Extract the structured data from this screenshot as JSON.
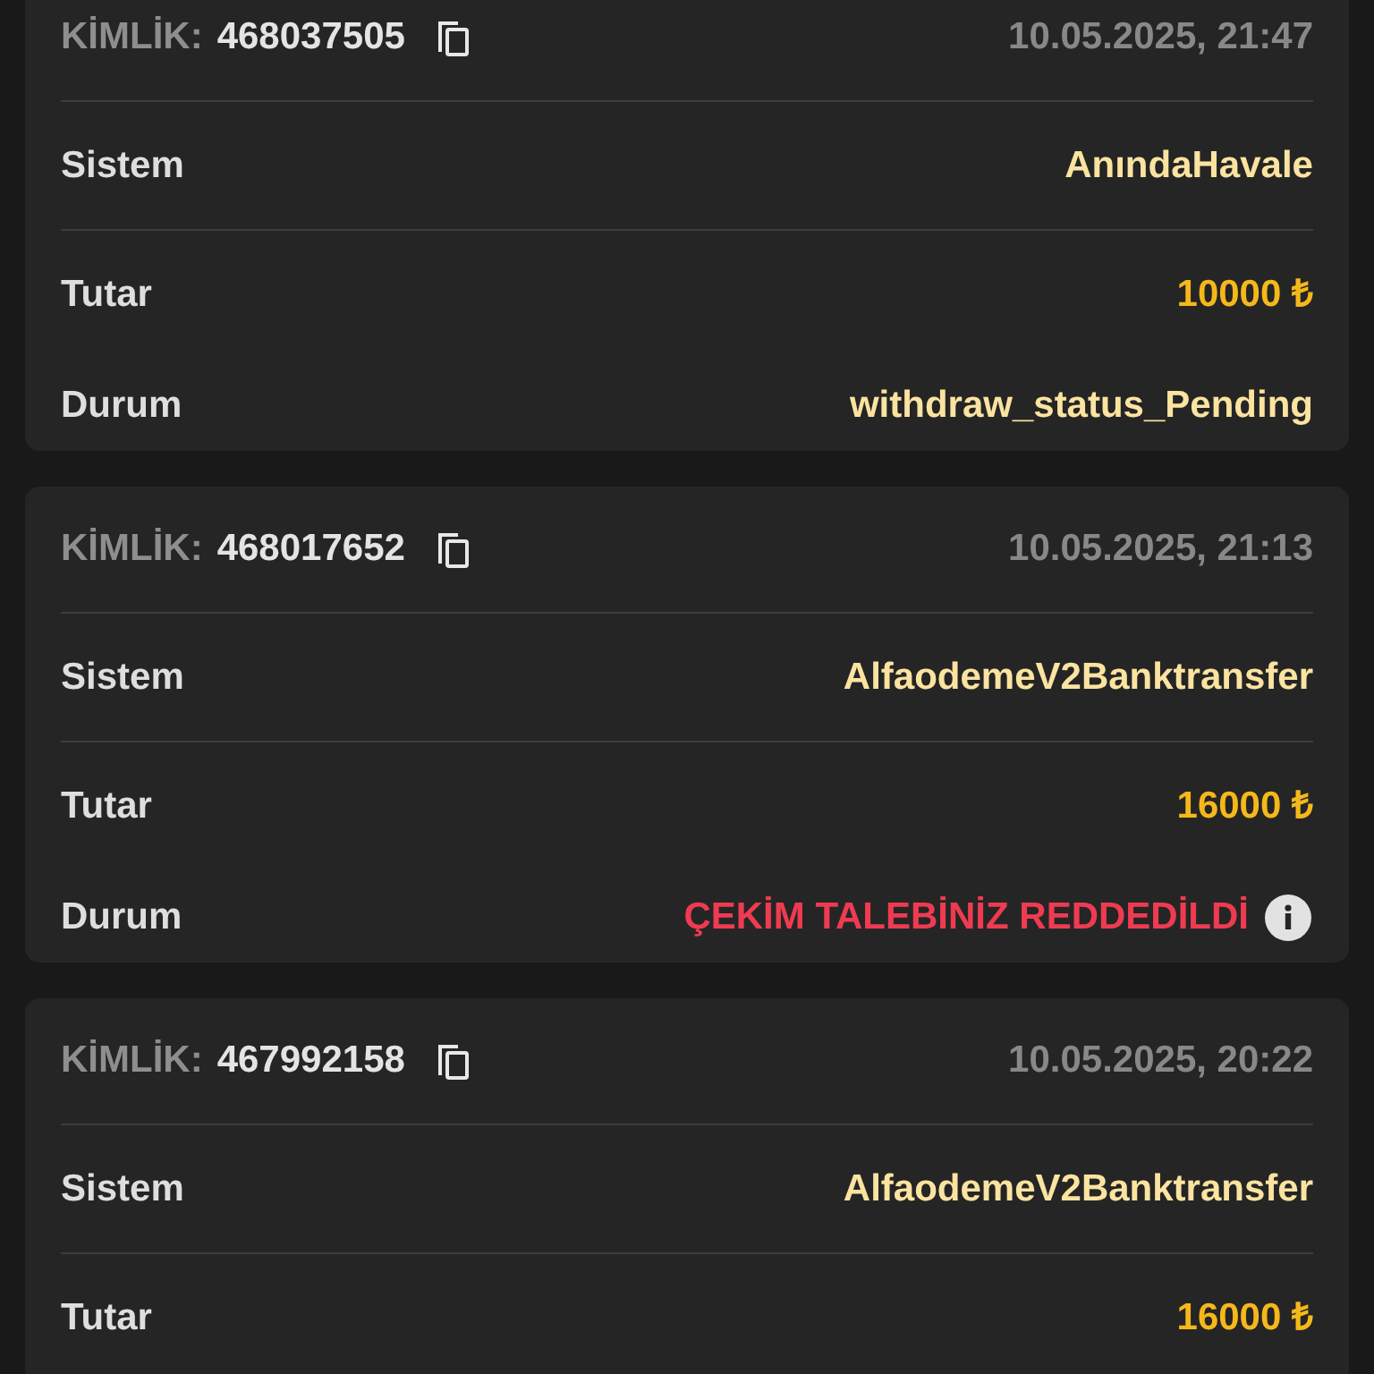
{
  "transactions": [
    {
      "id_label": "KİMLİK:",
      "id": "468037505",
      "date": "10.05.2025, 21:47",
      "fields": [
        {
          "label": "Sistem",
          "value": "AnındaHavale",
          "kind": "system"
        },
        {
          "label": "Tutar",
          "value": "10000 ₺",
          "kind": "amount"
        },
        {
          "label": "Durum",
          "value": "withdraw_status_Pending",
          "kind": "pending"
        }
      ]
    },
    {
      "id_label": "KİMLİK:",
      "id": "468017652",
      "date": "10.05.2025, 21:13",
      "fields": [
        {
          "label": "Sistem",
          "value": "AlfaodemeV2Banktransfer",
          "kind": "system"
        },
        {
          "label": "Tutar",
          "value": "16000 ₺",
          "kind": "amount"
        },
        {
          "label": "Durum",
          "value": "ÇEKİM TALEBİNİZ REDDEDİLDİ",
          "kind": "rejected"
        }
      ]
    },
    {
      "id_label": "KİMLİK:",
      "id": "467992158",
      "date": "10.05.2025, 20:22",
      "fields": [
        {
          "label": "Sistem",
          "value": "AlfaodemeV2Banktransfer",
          "kind": "system"
        },
        {
          "label": "Tutar",
          "value": "16000 ₺",
          "kind": "amount"
        }
      ]
    }
  ]
}
